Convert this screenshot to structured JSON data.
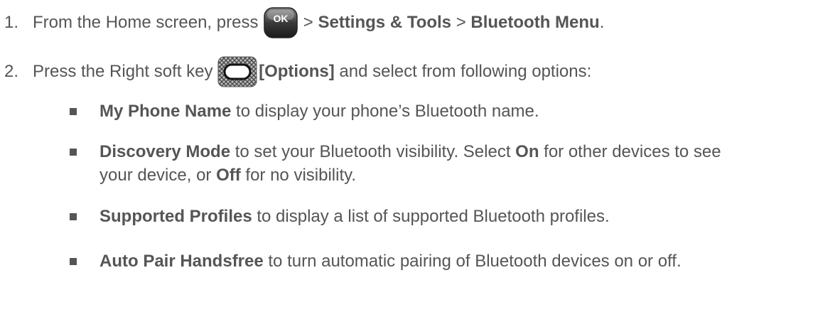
{
  "steps": [
    {
      "num": "1.",
      "parts": [
        "From the Home screen, press ",
        " > ",
        "Settings & Tools",
        " > ",
        "Bluetooth Menu",
        "."
      ],
      "ok_key_label": "OK"
    },
    {
      "num": "2.",
      "parts": [
        "Press the Right soft key ",
        "[Options]",
        " and select from following options:"
      ]
    }
  ],
  "options": [
    {
      "term": "My Phone Name",
      "desc": " to display your phone’s Bluetooth name."
    },
    {
      "term": "Discovery Mode",
      "desc_line1_a": " to set your Bluetooth visibility. Select ",
      "on": "On",
      "desc_line1_b": " for other devices to see",
      "desc_line2_a": "your device, or ",
      "off": "Off",
      "desc_line2_b": " for no visibility."
    },
    {
      "term": "Supported Profiles",
      "desc": " to display a list of supported Bluetooth profiles."
    },
    {
      "term": "Auto Pair Handsfree",
      "desc": " to turn automatic pairing of Bluetooth devices on or off."
    }
  ],
  "icons": {
    "ok_key": "ok-key-icon",
    "right_soft_key": "right-soft-key-icon"
  }
}
